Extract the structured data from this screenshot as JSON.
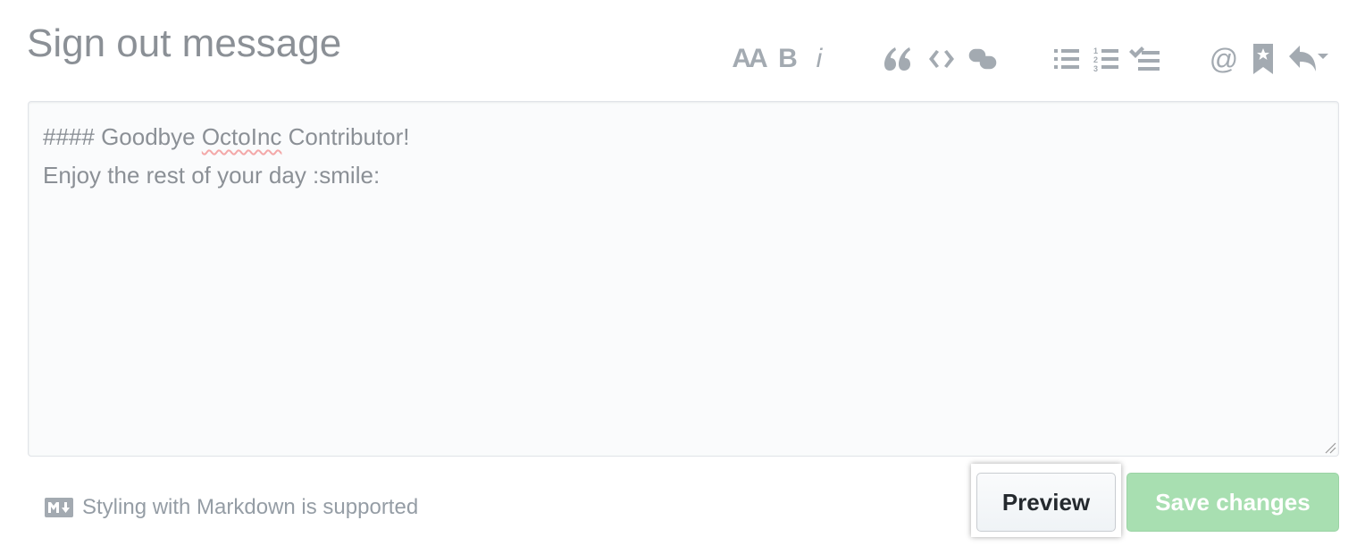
{
  "title": "Sign out message",
  "toolbar": [
    {
      "name": "text-size-icon",
      "glyph": "AA"
    },
    {
      "name": "bold-icon",
      "glyph": "B"
    },
    {
      "name": "italic-icon",
      "glyph": "i"
    },
    {
      "name": "quote-icon"
    },
    {
      "name": "code-icon"
    },
    {
      "name": "link-icon"
    },
    {
      "name": "unordered-list-icon"
    },
    {
      "name": "ordered-list-icon"
    },
    {
      "name": "task-list-icon"
    },
    {
      "name": "mention-icon",
      "glyph": "@"
    },
    {
      "name": "saved-replies-icon"
    },
    {
      "name": "reply-icon"
    }
  ],
  "editor": {
    "line1_prefix": "#### Goodbye ",
    "line1_misspelled": "OctoInc",
    "line1_suffix": " Contributor!",
    "line2": "Enjoy the rest of your day :smile:"
  },
  "footer": {
    "markdown_note": "Styling with Markdown is supported",
    "preview_label": "Preview",
    "save_label": "Save changes"
  },
  "colors": {
    "icon": "#a3aab1",
    "save_button": "#a8dfb1",
    "text": "#8b9096"
  }
}
